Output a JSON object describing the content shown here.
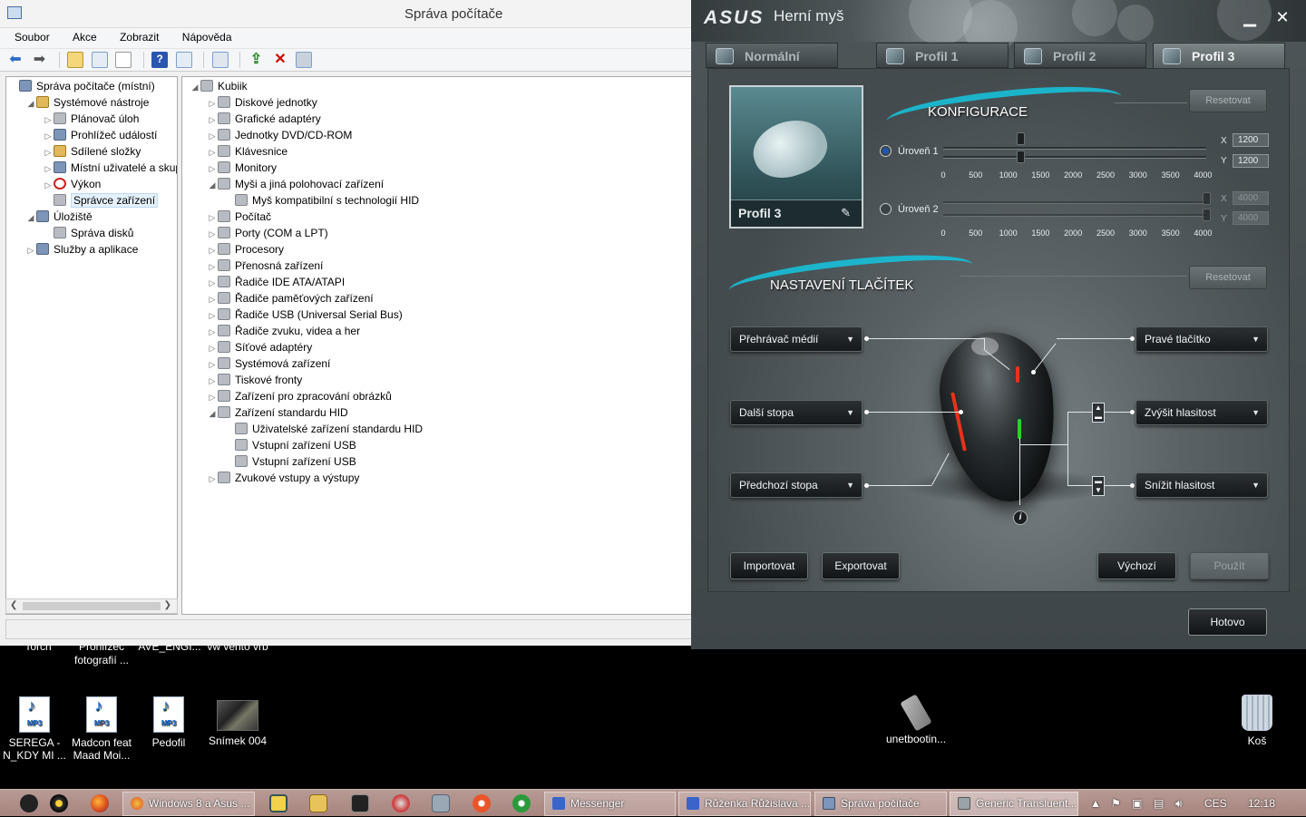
{
  "mmc": {
    "title": "Správa počítače",
    "menu": [
      "Soubor",
      "Akce",
      "Zobrazit",
      "Nápověda"
    ],
    "left_tree": [
      {
        "label": "Správa počítače (místní)",
        "indent": 0,
        "exp": "",
        "icon": "computer-management-icon"
      },
      {
        "label": "Systémové nástroje",
        "indent": 1,
        "exp": "◢",
        "icon": "tools-icon"
      },
      {
        "label": "Plánovač úloh",
        "indent": 2,
        "exp": "▷",
        "icon": "clock-icon"
      },
      {
        "label": "Prohlížeč událostí",
        "indent": 2,
        "exp": "▷",
        "icon": "event-viewer-icon"
      },
      {
        "label": "Sdílené složky",
        "indent": 2,
        "exp": "▷",
        "icon": "shared-folder-icon"
      },
      {
        "label": "Místní uživatelé a skupiny",
        "indent": 2,
        "exp": "▷",
        "icon": "users-icon"
      },
      {
        "label": "Výkon",
        "indent": 2,
        "exp": "▷",
        "icon": "performance-icon"
      },
      {
        "label": "Správce zařízení",
        "indent": 2,
        "exp": "",
        "icon": "device-manager-icon"
      },
      {
        "label": "Úložiště",
        "indent": 1,
        "exp": "◢",
        "icon": "storage-icon"
      },
      {
        "label": "Správa disků",
        "indent": 2,
        "exp": "",
        "icon": "disk-icon"
      },
      {
        "label": "Služby a aplikace",
        "indent": 1,
        "exp": "▷",
        "icon": "services-icon"
      }
    ],
    "device_tree": [
      {
        "label": "Kubiik",
        "indent": 0,
        "exp": "◢"
      },
      {
        "label": "Diskové jednotky",
        "indent": 1,
        "exp": "▷"
      },
      {
        "label": "Grafické adaptéry",
        "indent": 1,
        "exp": "▷"
      },
      {
        "label": "Jednotky DVD/CD-ROM",
        "indent": 1,
        "exp": "▷"
      },
      {
        "label": "Klávesnice",
        "indent": 1,
        "exp": "▷"
      },
      {
        "label": "Monitory",
        "indent": 1,
        "exp": "▷"
      },
      {
        "label": "Myši a jiná polohovací zařízení",
        "indent": 1,
        "exp": "◢"
      },
      {
        "label": "Myš kompatibilní s technologií HID",
        "indent": 2,
        "exp": ""
      },
      {
        "label": "Počítač",
        "indent": 1,
        "exp": "▷"
      },
      {
        "label": "Porty (COM a LPT)",
        "indent": 1,
        "exp": "▷"
      },
      {
        "label": "Procesory",
        "indent": 1,
        "exp": "▷"
      },
      {
        "label": "Přenosná zařízení",
        "indent": 1,
        "exp": "▷"
      },
      {
        "label": "Řadiče IDE ATA/ATAPI",
        "indent": 1,
        "exp": "▷"
      },
      {
        "label": "Řadiče paměťových zařízení",
        "indent": 1,
        "exp": "▷"
      },
      {
        "label": "Řadiče USB (Universal Serial Bus)",
        "indent": 1,
        "exp": "▷"
      },
      {
        "label": "Řadiče zvuku, videa a her",
        "indent": 1,
        "exp": "▷"
      },
      {
        "label": "Síťové adaptéry",
        "indent": 1,
        "exp": "▷"
      },
      {
        "label": "Systémová zařízení",
        "indent": 1,
        "exp": "▷"
      },
      {
        "label": "Tiskové fronty",
        "indent": 1,
        "exp": "▷"
      },
      {
        "label": "Zařízení pro zpracování obrázků",
        "indent": 1,
        "exp": "▷"
      },
      {
        "label": "Zařízení standardu HID",
        "indent": 1,
        "exp": "◢"
      },
      {
        "label": "Uživatelské zařízení standardu HID",
        "indent": 2,
        "exp": ""
      },
      {
        "label": "Vstupní zařízení USB",
        "indent": 2,
        "exp": ""
      },
      {
        "label": "Vstupní zařízení USB",
        "indent": 2,
        "exp": ""
      },
      {
        "label": "Zvukové vstupy a výstupy",
        "indent": 1,
        "exp": "▷"
      }
    ]
  },
  "asus": {
    "logo": "ASUS",
    "title": "Herní myš",
    "tabs": [
      "Normální",
      "Profil 1",
      "Profil 2",
      "Profil 3"
    ],
    "profile_name": "Profil 3",
    "config": {
      "title": "KONFIGURACE",
      "reset": "Resetovat",
      "level1": "Úroveň 1",
      "level2": "Úroveň 2",
      "ticks": [
        "0",
        "500",
        "1000",
        "1500",
        "2000",
        "2500",
        "3000",
        "3500",
        "4000"
      ],
      "x_label": "X",
      "y_label": "Y",
      "level1_x": "1200",
      "level1_y": "1200",
      "level2_x": "4000",
      "level2_y": "4000"
    },
    "buttons": {
      "title": "NASTAVENÍ TLAČÍTEK",
      "reset": "Resetovat",
      "left_top": "Přehrávač médií",
      "left_mid": "Další stopa",
      "left_bot": "Předchozí stopa",
      "right_top": "Pravé tlačítko",
      "right_mid": "Zvýšit hlasitost",
      "right_bot": "Snížit hlasitost"
    },
    "import": "Importovat",
    "export": "Exportovat",
    "default": "Výchozí",
    "apply": "Použít",
    "done": "Hotovo"
  },
  "desktop": {
    "cut_labels": [
      "Torch",
      "Prohlížeč fotografií ...",
      "AVE_ENGI...",
      "vw vento vrb"
    ],
    "icons": [
      {
        "label": "SEREGA - N_KDY MI ...",
        "type": "mp3"
      },
      {
        "label": "Madcon feat Maad Moi...",
        "type": "mp3"
      },
      {
        "label": "Pedofil",
        "type": "mp3"
      },
      {
        "label": "Snímek 004",
        "type": "photo"
      },
      {
        "label": "unetbootin...",
        "type": "usb"
      },
      {
        "label": "Koš",
        "type": "bin"
      }
    ]
  },
  "taskbar": {
    "buttons": [
      "Windows 8 a Asus ...",
      "Messenger",
      "Růženka Růžislava ...",
      "Správa počítače",
      "Generic Transluent..."
    ],
    "lang": "CES",
    "time": "12:18"
  }
}
